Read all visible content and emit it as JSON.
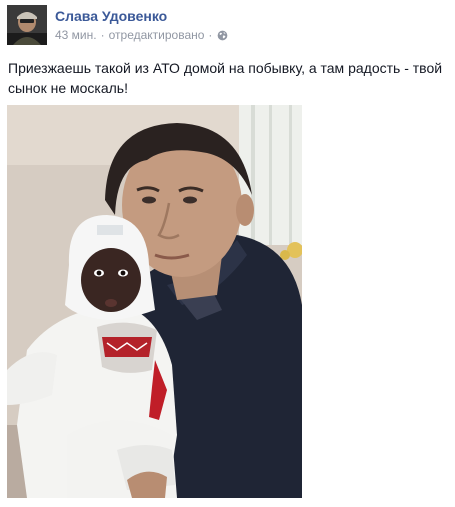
{
  "post": {
    "author": "Слава Удовенко",
    "time": "43 мин.",
    "separator": "·",
    "edited": "отредактировано",
    "privacy_icon": "globe-icon",
    "text": "Приезжаешь такой из АТО домой на побывку, а там радость - твой сынок не москаль!",
    "photo_icon": "photo-man-holding-baby"
  },
  "colors": {
    "author_link": "#3b5998",
    "meta_text": "#9197a3",
    "body_text": "#141823"
  }
}
